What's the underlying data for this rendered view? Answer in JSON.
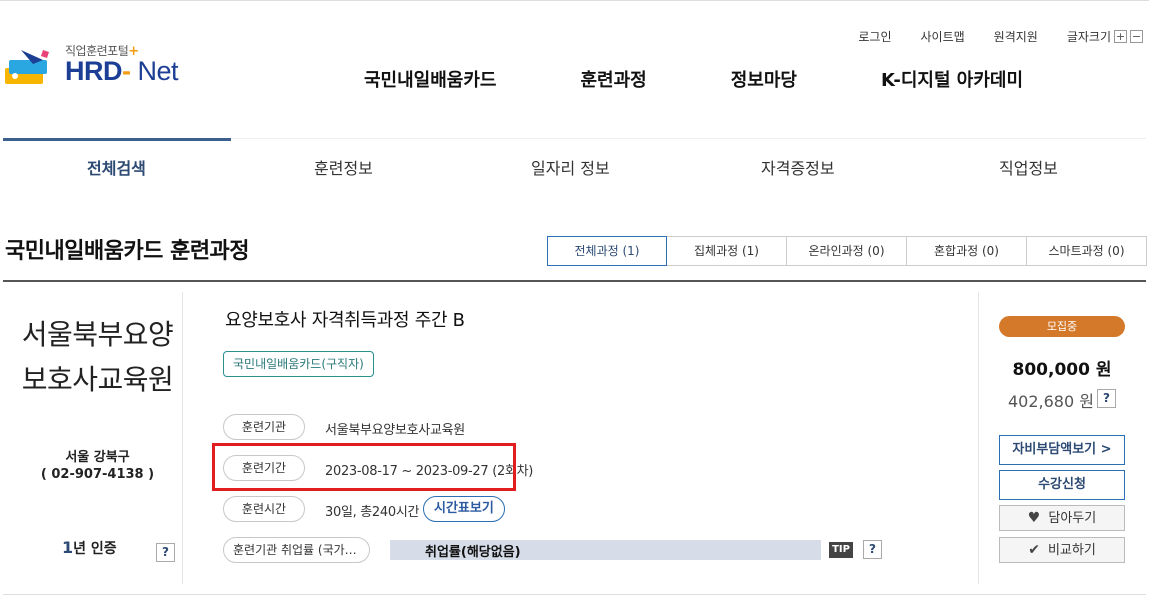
{
  "logo": {
    "subtitle": "직업훈련포털",
    "plus": "+",
    "name_a": "HRD",
    "name_dash": "-",
    "name_b": " Net"
  },
  "util": {
    "login": "로그인",
    "sitemap": "사이트맵",
    "remote": "원격지원",
    "fontsize": "글자크기",
    "plus": "+",
    "minus": "−"
  },
  "gnb": [
    "국민내일배움카드",
    "훈련과정",
    "정보마당",
    "K-디지털 아카데미"
  ],
  "subnav": [
    "전체검색",
    "훈련정보",
    "일자리 정보",
    "자격증정보",
    "직업정보"
  ],
  "page_title": "국민내일배움카드 훈련과정",
  "filter_tabs": [
    "전체과정 (1)",
    "집체과정 (1)",
    "온라인과정 (0)",
    "혼합과정 (0)",
    "스마트과정 (0)"
  ],
  "institution": {
    "name": "서울북부요양보호사교육원",
    "region": "서울 강북구",
    "phone": "( 02-907-4138 )",
    "cert_num": "1",
    "cert_label": "년 인증",
    "q": "?"
  },
  "course": {
    "title": "요양보호사 자격취득과정 주간 B",
    "tag": "국민내일배움카드(구직자)",
    "rows": [
      {
        "label": "훈련기관",
        "value": "서울북부요양보호사교육원"
      },
      {
        "label": "훈련기간",
        "value": "2023-08-17 ~ 2023-09-27 (2회차)"
      },
      {
        "label": "훈련시간",
        "value": "30일, 총240시간"
      }
    ],
    "timetable_btn": "시간표보기",
    "emp_label": "훈련기관 취업률 (국가…",
    "emp_value": "취업률(해당없음)",
    "tip": "TIP",
    "q": "?"
  },
  "side": {
    "status": "모집중",
    "price": "800,000 원",
    "self_price": "402,680 원",
    "q": "?",
    "self_btn": "자비부담액보기 >",
    "apply_btn": "수강신청",
    "wish_btn": "담아두기",
    "compare_btn": "비교하기"
  }
}
